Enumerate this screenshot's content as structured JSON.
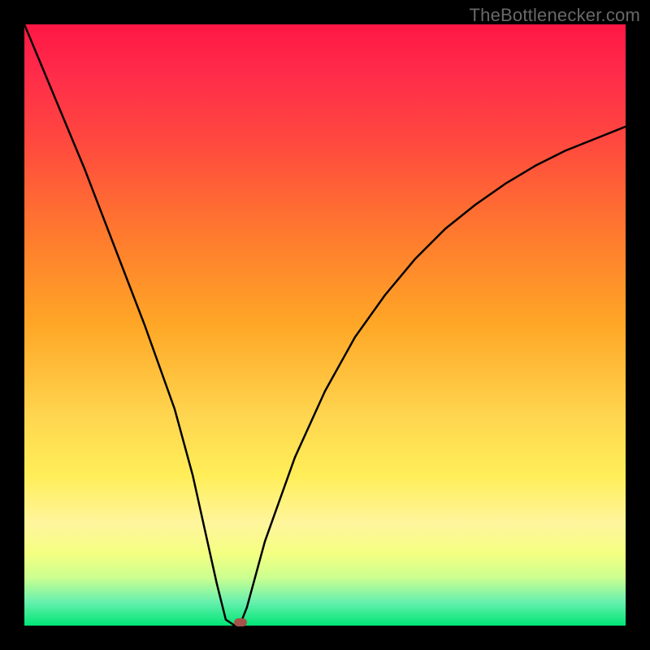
{
  "watermark": "TheBottlenecker.com",
  "chart_data": {
    "type": "line",
    "title": "",
    "xlabel": "",
    "ylabel": "",
    "xlim": [
      0,
      100
    ],
    "ylim": [
      0,
      100
    ],
    "series": [
      {
        "name": "bottleneck-curve",
        "x": [
          0,
          5,
          10,
          15,
          20,
          25,
          28,
          30,
          32,
          33.5,
          35,
          36,
          37,
          40,
          45,
          50,
          55,
          60,
          65,
          70,
          75,
          80,
          85,
          90,
          95,
          100
        ],
        "y": [
          100,
          88,
          76,
          63,
          50,
          36,
          25,
          16,
          7,
          1,
          0,
          0.5,
          3,
          14,
          28,
          39,
          48,
          55,
          61,
          66,
          70,
          73.5,
          76.5,
          79,
          81,
          83
        ]
      }
    ],
    "marker": {
      "x": 36,
      "y": 0.5
    },
    "gradient_stops": [
      {
        "pos": 0,
        "color": "#ff1744"
      },
      {
        "pos": 50,
        "color": "#ffa726"
      },
      {
        "pos": 75,
        "color": "#ffee58"
      },
      {
        "pos": 100,
        "color": "#00e676"
      }
    ]
  }
}
